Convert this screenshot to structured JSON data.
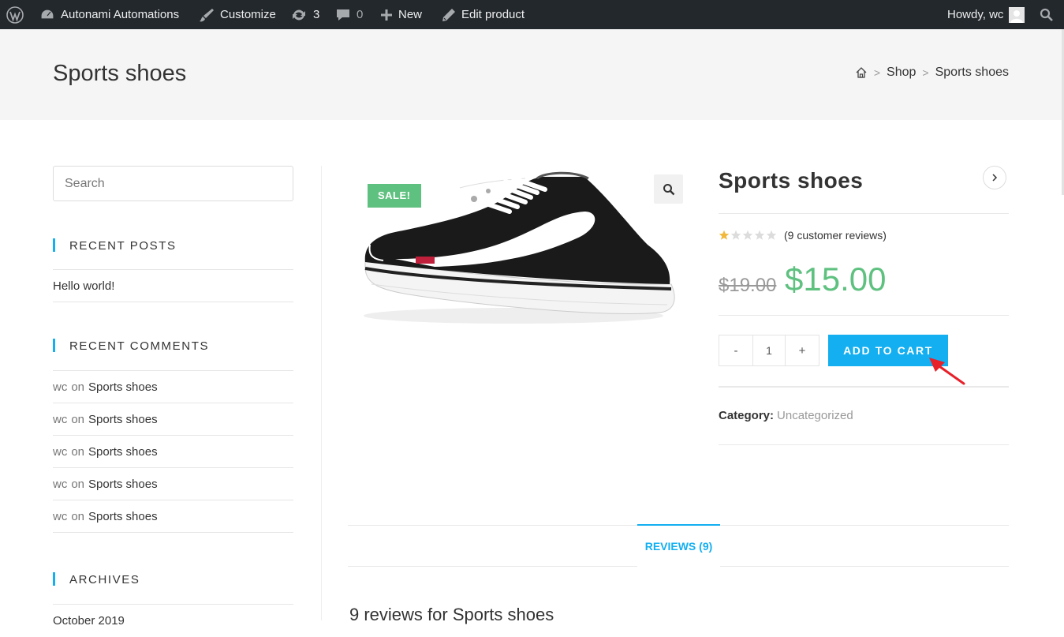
{
  "adminbar": {
    "site_name": "Autonami Automations",
    "customize": "Customize",
    "updates_count": "3",
    "comments_count": "0",
    "new": "New",
    "edit_product": "Edit product",
    "howdy": "Howdy, wc"
  },
  "header": {
    "title": "Sports shoes",
    "breadcrumb": [
      "Shop",
      "Sports shoes"
    ]
  },
  "sidebar": {
    "search_placeholder": "Search",
    "recent_posts_title": "RECENT POSTS",
    "recent_posts": [
      "Hello world!"
    ],
    "recent_comments_title": "RECENT COMMENTS",
    "recent_comments": [
      {
        "author": "wc",
        "on": "on",
        "post": "Sports shoes"
      },
      {
        "author": "wc",
        "on": "on",
        "post": "Sports shoes"
      },
      {
        "author": "wc",
        "on": "on",
        "post": "Sports shoes"
      },
      {
        "author": "wc",
        "on": "on",
        "post": "Sports shoes"
      },
      {
        "author": "wc",
        "on": "on",
        "post": "Sports shoes"
      }
    ],
    "archives_title": "ARCHIVES",
    "archives": [
      "October 2019"
    ]
  },
  "product": {
    "sale_badge": "SALE!",
    "title": "Sports shoes",
    "rating": 1,
    "rating_max": 5,
    "reviews_text": "(9 customer reviews)",
    "old_price": "$19.00",
    "new_price": "$15.00",
    "qty_minus": "-",
    "qty_value": "1",
    "qty_plus": "+",
    "add_to_cart": "ADD TO CART",
    "category_label": "Category:",
    "category_value": "Uncategorized",
    "tab_reviews": "REVIEWS (9)",
    "reviews_heading": "9 reviews for Sports shoes"
  },
  "colors": {
    "accent": "#13aff0",
    "sale": "#5fc180",
    "star": "#f1b83b",
    "adminbar": "#23282d"
  }
}
